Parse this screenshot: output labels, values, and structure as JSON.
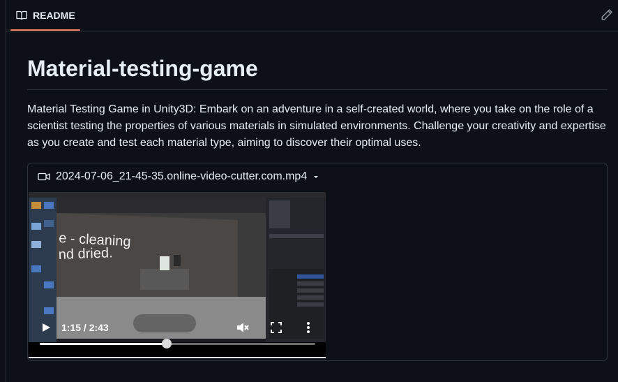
{
  "tab": {
    "label": "README",
    "icon": "book-icon"
  },
  "toolbar": {
    "edit_icon": "pencil-icon"
  },
  "readme": {
    "title": "Material-testing-game",
    "description": "Material Testing Game in Unity3D: Embark on an adventure in a self-created world, where you take on the role of a scientist testing the properties of various materials in simulated environments. Challenge your creativity and expertise as you create and test each material type, aiming to discover their optimal uses."
  },
  "video": {
    "filename": "2024-07-06_21-45-35.online-video-cutter.com.mp4",
    "icon": "video-icon",
    "current_time": "1:15 / 2:43",
    "progress": 0.46,
    "scene_text_line1": "e - cleaning",
    "scene_text_line2": "nd dried."
  },
  "colors": {
    "accent": "#f78166",
    "bg": "#0d1117",
    "border": "#30363d"
  }
}
